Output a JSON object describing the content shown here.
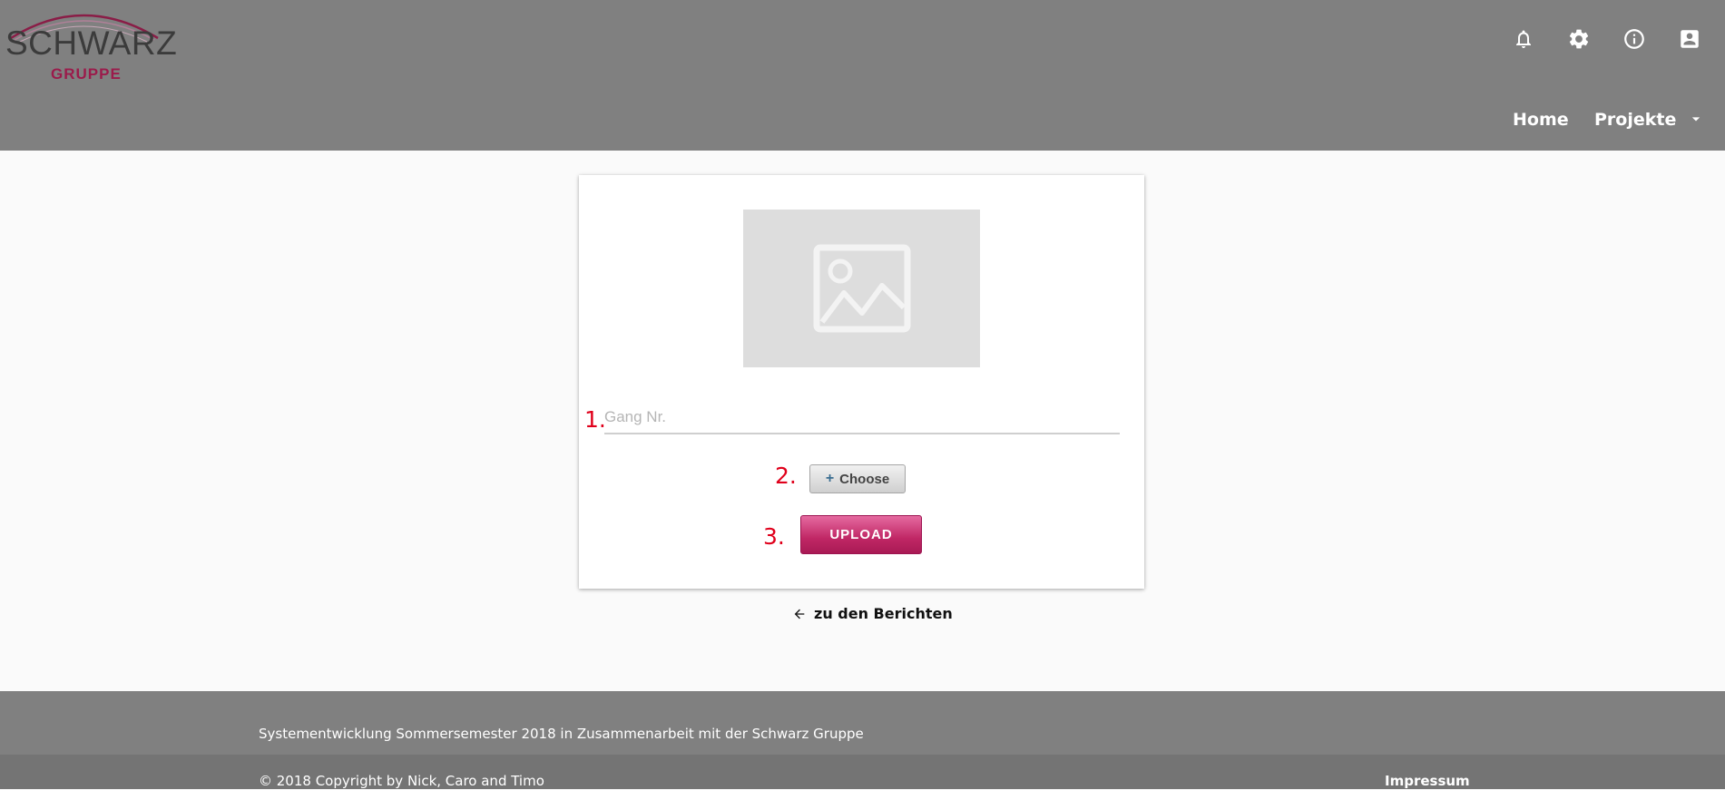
{
  "header": {
    "logo": {
      "name": "SCHWARZ",
      "sub": "GRUPPE"
    },
    "icons": [
      "bell-icon",
      "gear-icon",
      "info-icon",
      "account-box-icon"
    ],
    "nav": {
      "home": "Home",
      "projects": "Projekte"
    }
  },
  "form": {
    "image_placeholder_icon": "image-icon",
    "steps": {
      "one": "1.",
      "two": "2.",
      "three": "3."
    },
    "gang_placeholder": "Gang Nr.",
    "gang_value": "",
    "choose_label": "Choose",
    "upload_label": "UPLOAD"
  },
  "back_link": {
    "label": "zu den Berichten",
    "icon": "arrow-left-icon"
  },
  "footer": {
    "description": "Systementwicklung Sommersemester 2018 in Zusammenarbeit mit der Schwarz Gruppe",
    "copyright": "© 2018 Copyright by Nick, Caro and Timo",
    "impressum": "Impressum"
  },
  "colors": {
    "header_bg": "#808080",
    "brand": "#9b1b4b",
    "step_number": "#e0001b",
    "upload_button": "#c02765"
  }
}
